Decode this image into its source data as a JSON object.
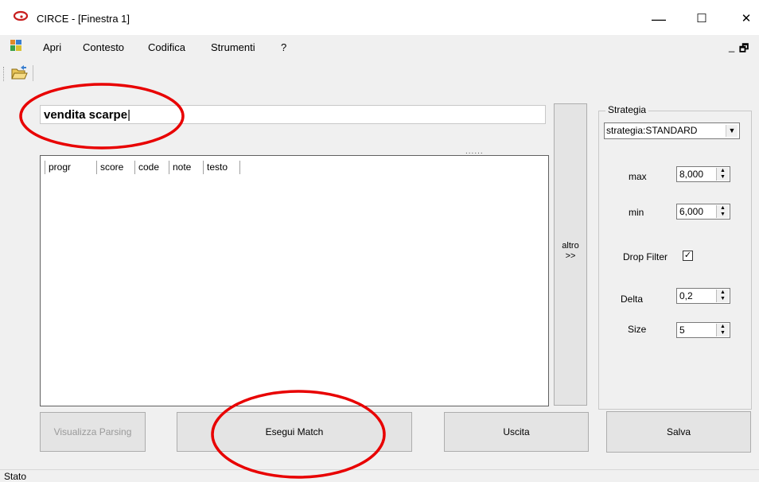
{
  "window": {
    "title": "CIRCE - [Finestra 1]",
    "controls": {
      "minimize": "—",
      "maximize": "☐",
      "close": "✕"
    }
  },
  "menu": {
    "items": [
      "Apri",
      "Contesto",
      "Codifica",
      "Strumenti",
      "?"
    ],
    "mdi_minimize": "_",
    "mdi_restore": "🗗"
  },
  "search": {
    "value": "vendita scarpe"
  },
  "splitter": {
    "dots": "......"
  },
  "results": {
    "columns": [
      "progr",
      "score",
      "code",
      "note",
      "testo"
    ]
  },
  "altro_button": {
    "line1": "altro",
    "line2": ">>"
  },
  "strategia": {
    "legend": "Strategia",
    "selected": "strategia:STANDARD",
    "max_label": "max",
    "max_value": "8,000",
    "min_label": "min",
    "min_value": "6,000",
    "drop_filter_label": "Drop Filter",
    "drop_filter_checked": true,
    "delta_label": "Delta",
    "delta_value": "0,2",
    "size_label": "Size",
    "size_value": "5"
  },
  "buttons": {
    "visualizza": "Visualizza Parsing",
    "esegui": "Esegui Match",
    "uscita": "Uscita",
    "salva": "Salva"
  },
  "status": {
    "text": "Stato"
  },
  "colors": {
    "annotation": "#e80000",
    "app_icon": "#c81e1e"
  }
}
